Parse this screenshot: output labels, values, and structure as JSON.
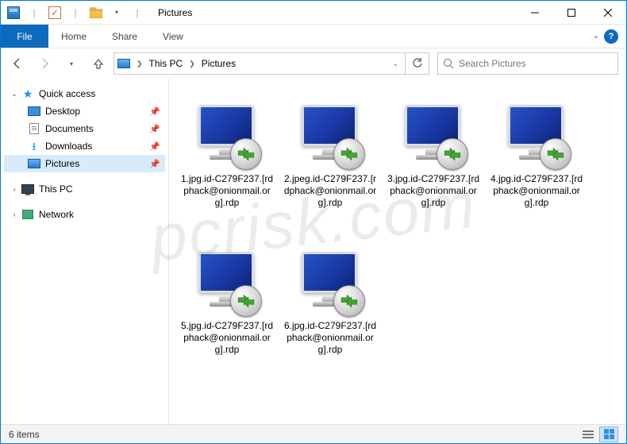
{
  "titlebar": {
    "title": "Pictures"
  },
  "ribbon": {
    "file": "File",
    "tabs": [
      "Home",
      "Share",
      "View"
    ]
  },
  "breadcrumb": {
    "items": [
      "This PC",
      "Pictures"
    ]
  },
  "search": {
    "placeholder": "Search Pictures"
  },
  "sidebar": {
    "quick_access": "Quick access",
    "desktop": "Desktop",
    "documents": "Documents",
    "downloads": "Downloads",
    "pictures": "Pictures",
    "this_pc": "This PC",
    "network": "Network"
  },
  "files": [
    {
      "name": "1.jpg.id-C279F237.[rdphack@onionmail.org].rdp"
    },
    {
      "name": "2.jpeg.id-C279F237.[rdphack@onionmail.org].rdp"
    },
    {
      "name": "3.jpg.id-C279F237.[rdphack@onionmail.org].rdp"
    },
    {
      "name": "4.jpg.id-C279F237.[rdphack@onionmail.org].rdp"
    },
    {
      "name": "5.jpg.id-C279F237.[rdphack@onionmail.org].rdp"
    },
    {
      "name": "6.jpg.id-C279F237.[rdphack@onionmail.org].rdp"
    }
  ],
  "statusbar": {
    "count_label": "6 items"
  },
  "watermark": "pcrisk.com"
}
